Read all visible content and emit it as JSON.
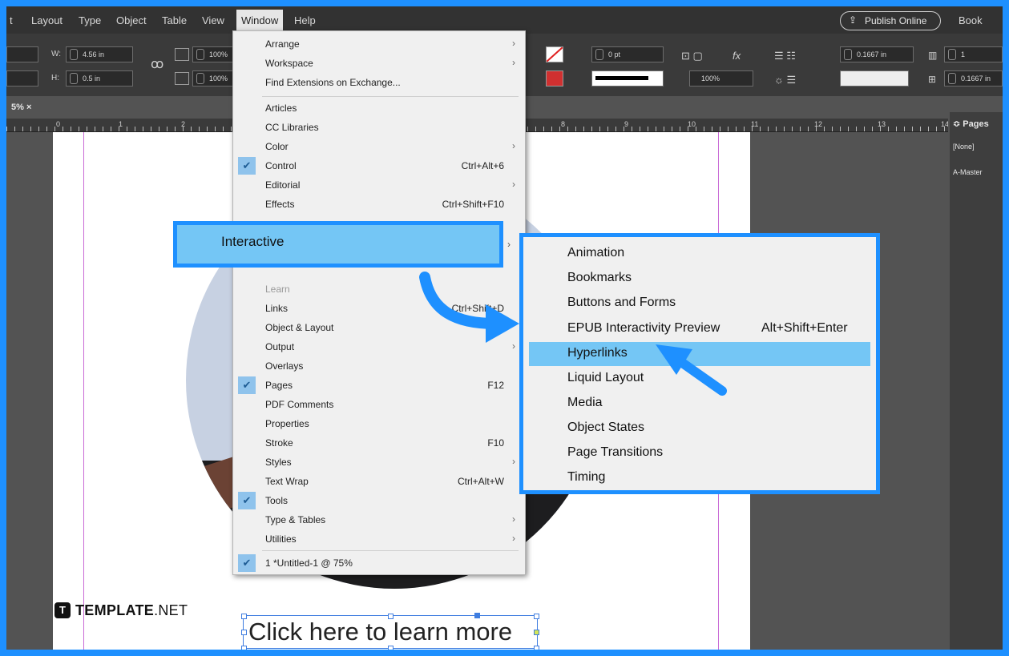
{
  "menubar": {
    "items": [
      {
        "label": "t",
        "x": 0
      },
      {
        "label": "Layout"
      },
      {
        "label": "Type"
      },
      {
        "label": "Object"
      },
      {
        "label": "Table"
      },
      {
        "label": "View"
      }
    ],
    "window_label": "Window",
    "help_label": "Help",
    "publish_label": "Publish Online",
    "book_label": "Book"
  },
  "controlbar": {
    "w_label": "W:",
    "w_value": "4.56 in",
    "h_label": "H:",
    "h_value": "0.5 in",
    "scale_x": "100%",
    "scale_y": "100%",
    "stroke_weight": "0 pt",
    "opacity": "100%",
    "inset_1": "0.1667 in",
    "columns": "1",
    "inset_2": "0.1667 in"
  },
  "tab": {
    "label": "5% ×"
  },
  "ruler": {
    "numbers": [
      "0",
      "1",
      "2",
      "8",
      "9",
      "10",
      "11",
      "12",
      "13",
      "14"
    ]
  },
  "pages_panel": {
    "title": "≎ Pages",
    "item_none": "[None]",
    "item_master": "A-Master"
  },
  "window_menu": {
    "items": [
      {
        "label": "Arrange",
        "submenu": true
      },
      {
        "label": "Workspace",
        "submenu": true
      },
      {
        "label": "Find Extensions on Exchange..."
      },
      {
        "label": "Articles"
      },
      {
        "label": "CC Libraries"
      },
      {
        "label": "Color",
        "submenu": true
      },
      {
        "label": "Control",
        "shortcut": "Ctrl+Alt+6",
        "checked": true
      },
      {
        "label": "Editorial",
        "submenu": true
      },
      {
        "label": "Effects",
        "shortcut": "Ctrl+Shift+F10"
      },
      {
        "label": "Learn",
        "disabled": true
      },
      {
        "label": "Links",
        "shortcut": "Ctrl+Shift+D"
      },
      {
        "label": "Object & Layout"
      },
      {
        "label": "Output",
        "submenu": true
      },
      {
        "label": "Overlays"
      },
      {
        "label": "Pages",
        "shortcut": "F12",
        "checked": true
      },
      {
        "label": "PDF Comments"
      },
      {
        "label": "Properties"
      },
      {
        "label": "Stroke",
        "shortcut": "F10"
      },
      {
        "label": "Styles",
        "submenu": true
      },
      {
        "label": "Text Wrap",
        "shortcut": "Ctrl+Alt+W"
      },
      {
        "label": "Tools",
        "checked": true
      },
      {
        "label": "Type & Tables",
        "submenu": true
      },
      {
        "label": "Utilities",
        "submenu": true
      },
      {
        "label": "1 *Untitled-1 @ 75%",
        "checked": true
      }
    ],
    "interactive_label": "Interactive"
  },
  "submenu": {
    "items": [
      {
        "label": "Animation"
      },
      {
        "label": "Bookmarks"
      },
      {
        "label": "Buttons and Forms"
      },
      {
        "label": "EPUB Interactivity Preview",
        "shortcut": "Alt+Shift+Enter"
      },
      {
        "label": "Hyperlinks",
        "highlighted": true
      },
      {
        "label": "Liquid Layout"
      },
      {
        "label": "Media"
      },
      {
        "label": "Object States"
      },
      {
        "label": "Page Transitions"
      },
      {
        "label": "Timing"
      }
    ]
  },
  "page": {
    "logo_text": "TEMPLATE",
    "logo_suffix": ".NET",
    "logo_mark": "T",
    "text_frame": "Click here to learn more"
  },
  "colors": {
    "accent": "#1e90ff",
    "highlight": "#74c6f5",
    "guide": "#c96bd6"
  }
}
